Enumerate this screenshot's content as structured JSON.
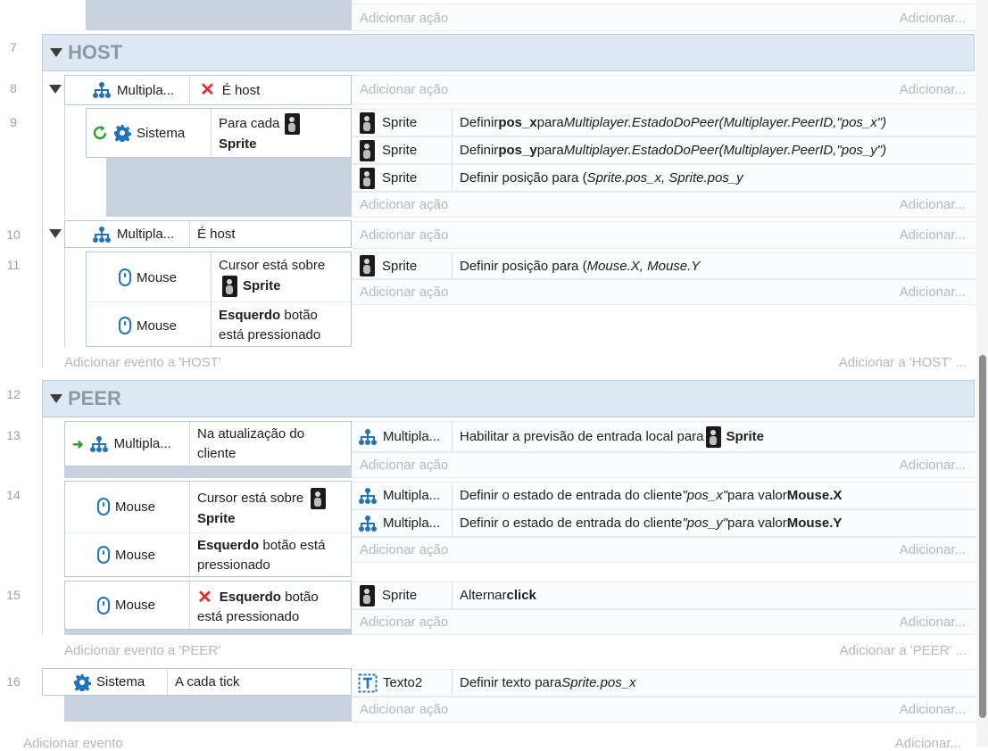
{
  "row_numbers": [
    "7",
    "8",
    "9",
    "10",
    "11",
    "12",
    "13",
    "14",
    "15",
    "16"
  ],
  "add_action": "Adicionar ação",
  "add_more": "Adicionar...",
  "groups": {
    "host": {
      "title": "HOST",
      "add_event": "Adicionar evento a 'HOST'",
      "add_right": "Adicionar a 'HOST' ..."
    },
    "peer": {
      "title": "PEER",
      "add_event": "Adicionar evento a 'PEER'",
      "add_right": "Adicionar a 'PEER' ..."
    }
  },
  "ev8": {
    "object": "Multipla...",
    "condition": "É host"
  },
  "ev9": {
    "object": "Sistema",
    "cond_pre": "Para cada",
    "cond_obj": "Sprite",
    "actions": [
      {
        "object": "Sprite",
        "pre": "Definir ",
        "bold": "pos_x",
        "mid": " para ",
        "italic": "Multiplayer.EstadoDoPeer(Multiplayer.PeerID,\"pos_x\")"
      },
      {
        "object": "Sprite",
        "pre": "Definir ",
        "bold": "pos_y",
        "mid": " para ",
        "italic": "Multiplayer.EstadoDoPeer(Multiplayer.PeerID,\"pos_y\")"
      },
      {
        "object": "Sprite",
        "pre": "Definir posição para (",
        "italic": "Sprite.pos_x, Sprite.pos_y"
      }
    ]
  },
  "ev10": {
    "object": "Multipla...",
    "condition": "É host"
  },
  "ev11": {
    "c1_object": "Mouse",
    "c1_line1": "Cursor está sobre",
    "c1_obj": "Sprite",
    "c2_object": "Mouse",
    "c2_bold": "Esquerdo",
    "c2_rest": " botão",
    "c2_line2": "está pressionado",
    "action": {
      "object": "Sprite",
      "pre": "Definir posição para (",
      "italic": "Mouse.X, Mouse.Y"
    }
  },
  "ev13": {
    "object": "Multipla...",
    "cond_line1": "Na atualização do",
    "cond_line2": "cliente",
    "action": {
      "object": "Multipla...",
      "text": "Habilitar a previsão de entrada local para ",
      "bold": "Sprite"
    }
  },
  "ev14": {
    "c1_object": "Mouse",
    "c1_line1": "Cursor está sobre",
    "c1_obj": "Sprite",
    "c2_object": "Mouse",
    "c2_bold": "Esquerdo",
    "c2_rest": " botão está",
    "c2_line2": "pressionado",
    "actions": [
      {
        "object": "Multipla...",
        "pre": "Definir o estado de entrada do cliente ",
        "italic": "\"pos_x\"",
        "mid": " para valor ",
        "bold": "Mouse.X"
      },
      {
        "object": "Multipla...",
        "pre": "Definir o estado de entrada do cliente ",
        "italic": "\"pos_y\"",
        "mid": " para valor ",
        "bold": "Mouse.Y"
      }
    ]
  },
  "ev15": {
    "object": "Mouse",
    "cond_bold": "Esquerdo",
    "cond_rest": " botão",
    "cond_line2": "está pressionado",
    "action": {
      "object": "Sprite",
      "pre": "Alternar ",
      "bold": "click"
    }
  },
  "ev16": {
    "object": "Sistema",
    "condition": "A cada tick",
    "action": {
      "object": "Texto2",
      "pre": "Definir texto para ",
      "italic": "Sprite.pos_x"
    }
  },
  "footer": {
    "add_event": "Adicionar evento",
    "add_right": "Adicionar..."
  },
  "colors": {
    "accent": "#2472b8",
    "group_bg": "#dde8f3",
    "cond_pad": "#c8d2de",
    "error_x": "#e12b2b",
    "loop_green": "#2e9b2e"
  },
  "icons": [
    "network-icon",
    "gear-icon",
    "mouse-icon",
    "sprite-icon",
    "text-object-icon",
    "loop-icon",
    "trigger-arrow-icon",
    "invert-x-icon",
    "collapse-triangle-icon"
  ]
}
